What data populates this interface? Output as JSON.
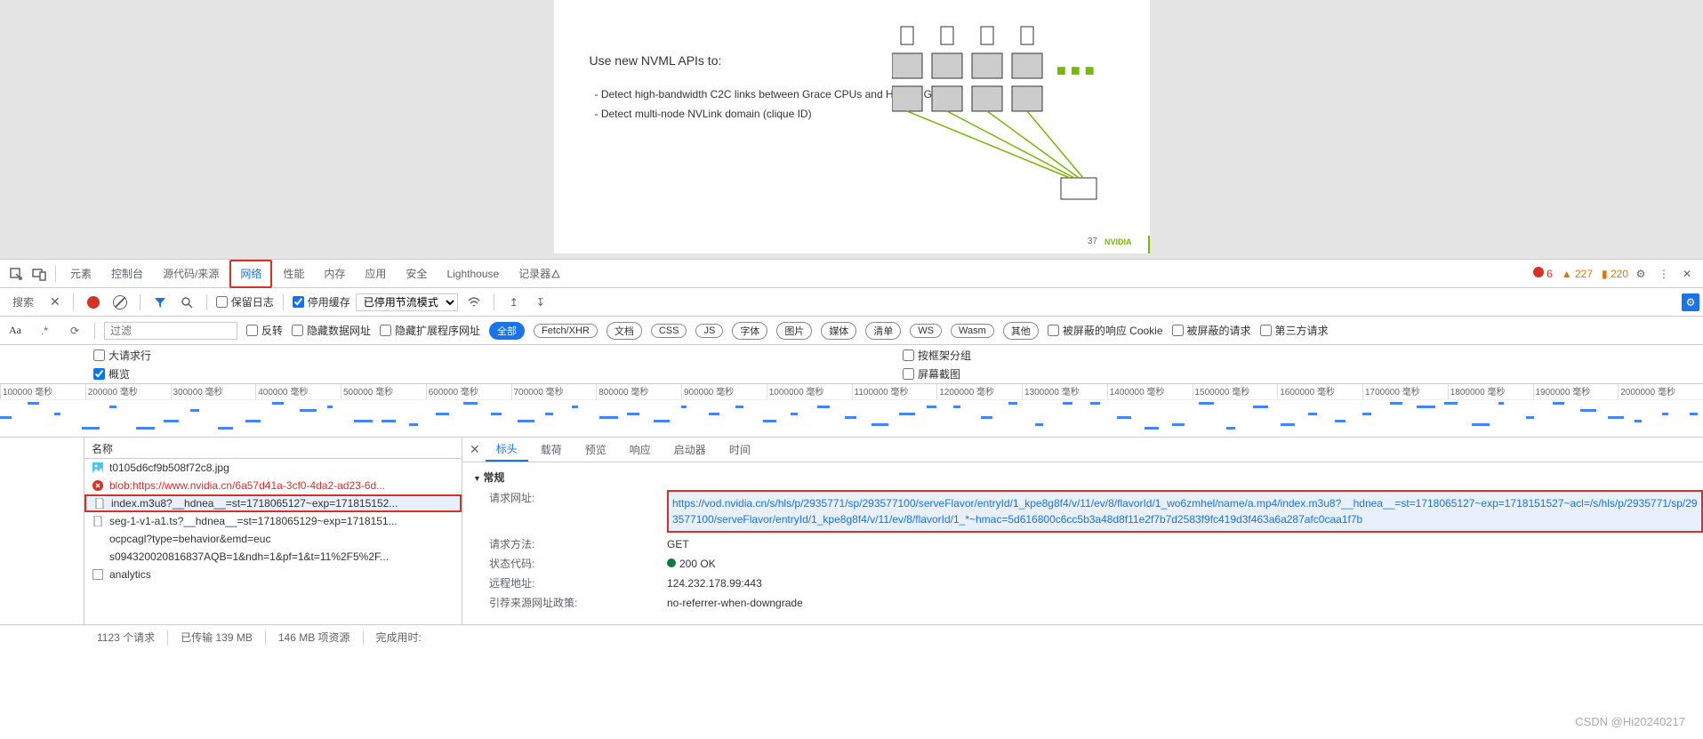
{
  "slide": {
    "title": "Use new NVML APIs to:",
    "bullet1": "- Detect high-bandwidth C2C links between Grace CPUs and Hopper GPUs",
    "bullet2": "- Detect multi-node NVLink domain (clique ID)",
    "pagenum": "37",
    "brand": "NVIDIA"
  },
  "tabs": {
    "elements": "元素",
    "console": "控制台",
    "sources": "源代码/来源",
    "network": "网络",
    "performance": "性能",
    "memory": "内存",
    "application": "应用",
    "security": "安全",
    "lighthouse": "Lighthouse",
    "recorder": "记录器"
  },
  "errors": {
    "err": "6",
    "warn": "227",
    "info": "220"
  },
  "search": {
    "label": "搜索",
    "filter_placeholder": "过滤",
    "preserve_log": "保留日志",
    "disable_cache": "停用缓存",
    "throttling": "已停用节流模式",
    "invert": "反转",
    "hide_data": "隐藏数据网址",
    "hide_ext": "隐藏扩展程序网址"
  },
  "types": {
    "all": "全部",
    "fetch": "Fetch/XHR",
    "doc": "文档",
    "css": "CSS",
    "js": "JS",
    "font": "字体",
    "img": "图片",
    "media": "媒体",
    "manifest": "清单",
    "ws": "WS",
    "wasm": "Wasm",
    "other": "其他",
    "blocked_cookies": "被屏蔽的响应 Cookie",
    "blocked_req": "被屏蔽的请求",
    "third_party": "第三方请求"
  },
  "options": {
    "large_rows": "大请求行",
    "group_frame": "按框架分组",
    "overview": "概览",
    "screenshots": "屏幕截图"
  },
  "timeline_ticks": [
    "100000 毫秒",
    "200000 毫秒",
    "300000 毫秒",
    "400000 毫秒",
    "500000 毫秒",
    "600000 毫秒",
    "700000 毫秒",
    "800000 毫秒",
    "900000 毫秒",
    "1000000 毫秒",
    "1100000 毫秒",
    "1200000 毫秒",
    "1300000 毫秒",
    "1400000 毫秒",
    "1500000 毫秒",
    "1600000 毫秒",
    "1700000 毫秒",
    "1800000 毫秒",
    "1900000 毫秒",
    "2000000 毫秒"
  ],
  "req": {
    "header": "名称",
    "items": [
      {
        "name": "t0105d6cf9b508f72c8.jpg",
        "icon": "img"
      },
      {
        "name": "blob:https://www.nvidia.cn/6a57d41a-3cf0-4da2-ad23-6d...",
        "icon": "err"
      },
      {
        "name": "index.m3u8?__hdnea__=st=1718065127~exp=171815152...",
        "icon": "doc",
        "selected": true
      },
      {
        "name": "seg-1-v1-a1.ts?__hdnea__=st=1718065129~exp=1718151...",
        "icon": "doc"
      },
      {
        "name": "ocpcagl?type=behavior&emd=euc",
        "icon": "none"
      },
      {
        "name": "s094320020816837AQB=1&ndh=1&pf=1&t=11%2F5%2F...",
        "icon": "none"
      },
      {
        "name": "analytics",
        "icon": "chk"
      }
    ]
  },
  "detail": {
    "tabs": {
      "headers": "标头",
      "payload": "载荷",
      "preview": "预览",
      "response": "响应",
      "initiator": "启动器",
      "timing": "时间"
    },
    "general": "常规",
    "url_label": "请求网址:",
    "url_value": "https://vod.nvidia.cn/s/hls/p/2935771/sp/293577100/serveFlavor/entryId/1_kpe8g8f4/v/11/ev/8/flavorId/1_wo6zmhel/name/a.mp4/index.m3u8?__hdnea__=st=1718065127~exp=1718151527~acl=/s/hls/p/2935771/sp/293577100/serveFlavor/entryId/1_kpe8g8f4/v/11/ev/8/flavorId/1_*~hmac=5d616800c6cc5b3a48d8f11e2f7b7d2583f9fc419d3f463a6a287afc0caa1f7b",
    "method_label": "请求方法:",
    "method_value": "GET",
    "status_label": "状态代码:",
    "status_value": "200 OK",
    "remote_label": "远程地址:",
    "remote_value": "124.232.178.99:443",
    "referrer_label": "引荐来源网址政策:",
    "referrer_value": "no-referrer-when-downgrade"
  },
  "statusbar": {
    "requests": "1123 个请求",
    "transferred": "已传输 139 MB",
    "resources": "146 MB 项资源",
    "finish": "完成用时:"
  },
  "watermark": "CSDN @Hi20240217"
}
